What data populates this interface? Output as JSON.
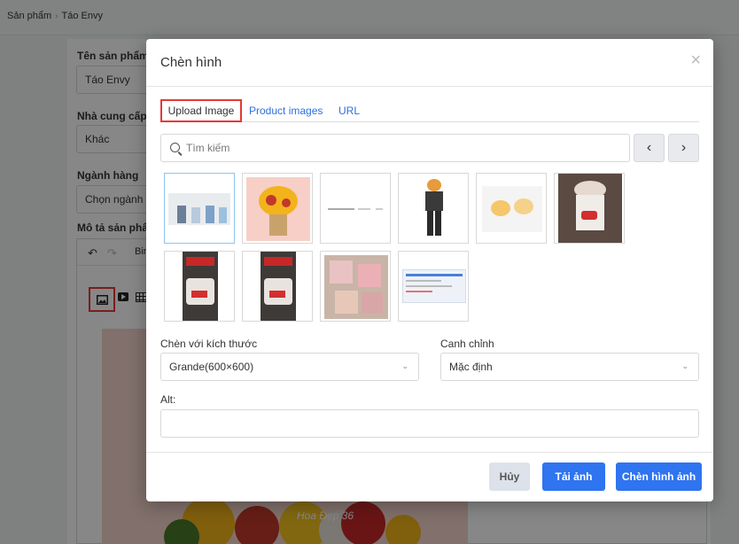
{
  "breadcrumb": {
    "parent": "Sản phẩm",
    "current": "Táo Envy"
  },
  "form": {
    "name_label": "Tên sản phẩm",
    "name_value": "Táo Envy",
    "supplier_label": "Nhà cung cấp",
    "supplier_value": "Khác",
    "category_label": "Ngành hàng",
    "category_value": "Chọn ngành l",
    "description_label": "Mô tả sản phẩm",
    "editor_toolbar_text": "Bin",
    "image_overlay_text": "Hoa Đẹp 36"
  },
  "modal": {
    "title": "Chèn hình",
    "tabs": [
      {
        "label": "Upload Image",
        "active": true
      },
      {
        "label": "Product images",
        "active": false
      },
      {
        "label": "URL",
        "active": false
      }
    ],
    "search_placeholder": "Tìm kiếm",
    "size_label": "Chèn với kích thước",
    "size_value": "Grande(600×600)",
    "align_label": "Canh chỉnh",
    "align_value": "Mặc định",
    "alt_label": "Alt:",
    "alt_value": "",
    "buttons": {
      "cancel": "Hủy",
      "upload": "Tải ảnh",
      "insert": "Chèn hình ảnh"
    }
  },
  "thumbnails": [
    {
      "name": "perfume-bottles-thumbnail",
      "selected": true
    },
    {
      "name": "flower-basket-thumbnail",
      "selected": false
    },
    {
      "name": "blank-document-thumbnail",
      "selected": false
    },
    {
      "name": "anime-figure-thumbnail",
      "selected": false
    },
    {
      "name": "cartoon-cats-thumbnail",
      "selected": false
    },
    {
      "name": "dq-dessert-cup-thumbnail",
      "selected": false
    },
    {
      "name": "dessert-video-thumbnail-1",
      "selected": false
    },
    {
      "name": "dessert-video-thumbnail-2",
      "selected": false
    },
    {
      "name": "eyeshadow-palettes-thumbnail",
      "selected": false
    },
    {
      "name": "webpage-screenshot-thumbnail",
      "selected": false
    }
  ],
  "colors": {
    "accent": "#2f74f0",
    "highlight": "#e53935",
    "link": "#2f6fde"
  }
}
